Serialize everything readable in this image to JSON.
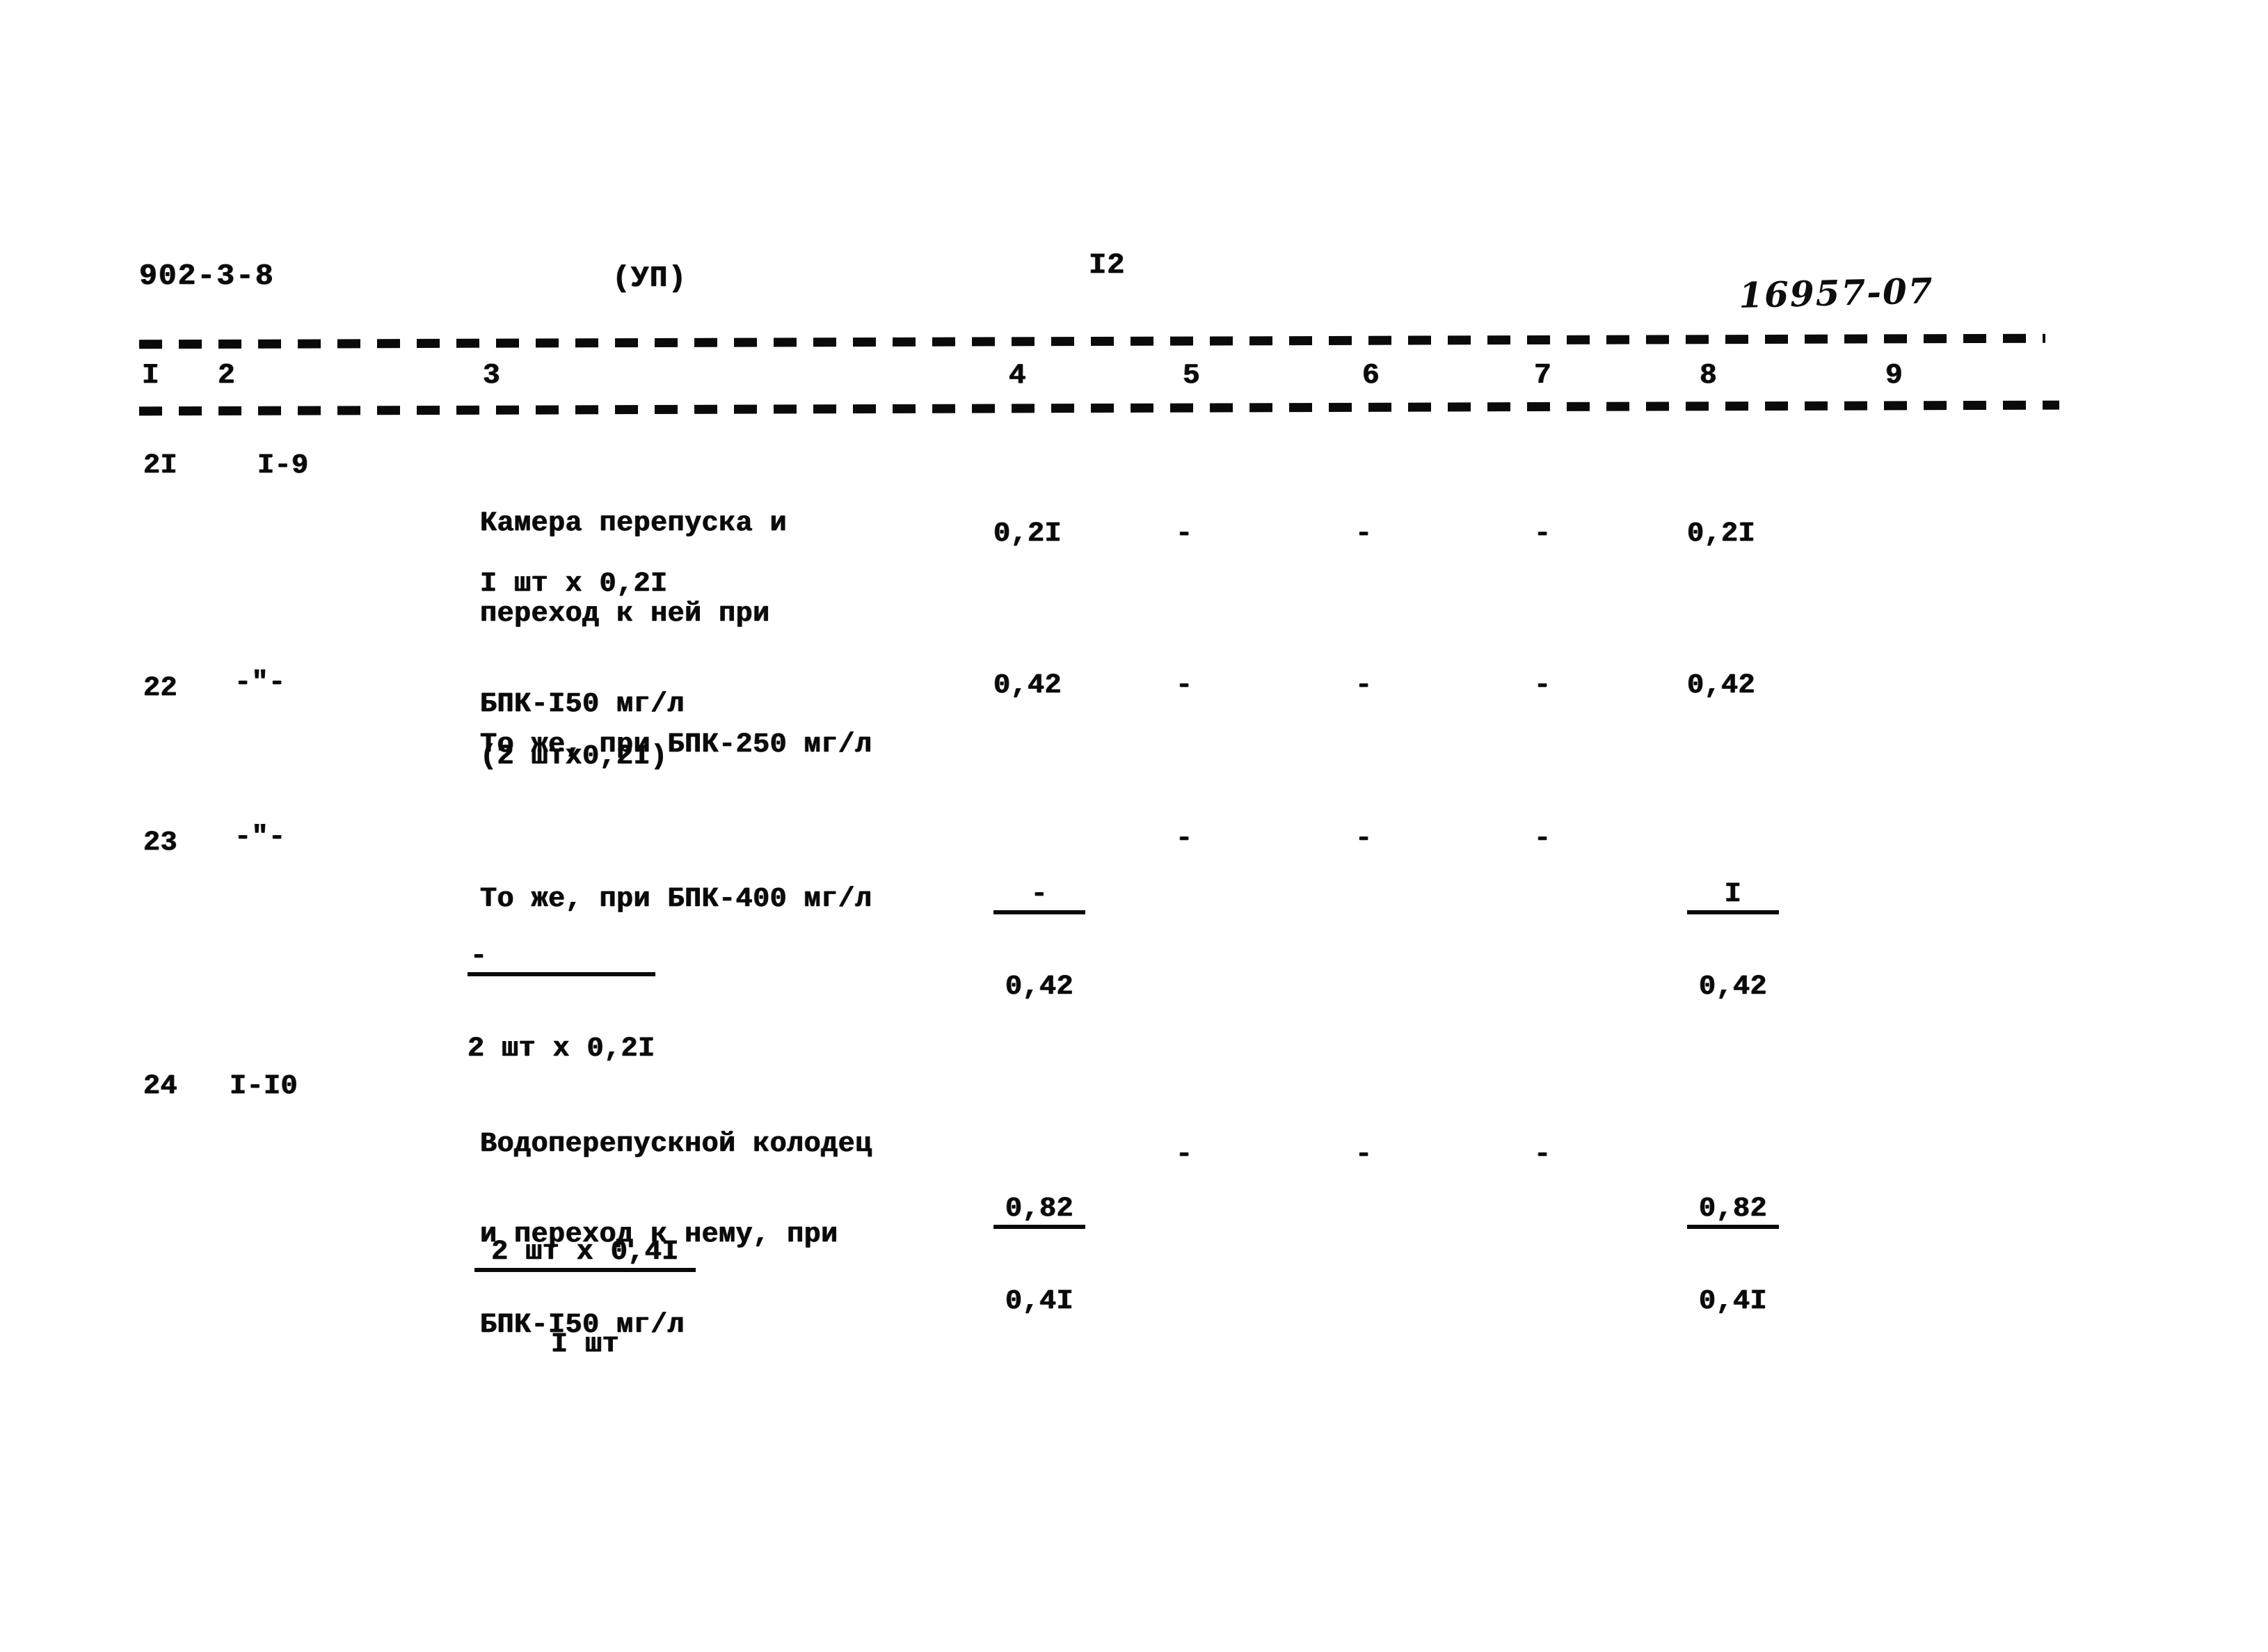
{
  "document": {
    "series_code": "902-3-8",
    "section_marker": "(УП)",
    "page_number": "I2",
    "archive_stamp": "16957-07"
  },
  "table": {
    "column_headers": [
      "I",
      "2",
      "3",
      "4",
      "5",
      "6",
      "7",
      "8",
      "9"
    ],
    "rows": [
      {
        "col1": "2I",
        "col2": "I-9",
        "col3_lines": [
          "Камера перепуска и",
          "переход к ней при",
          "БПК-I50 мг/л"
        ],
        "col3_note": "I шт х 0,2I",
        "col4": "0,2I",
        "col5": "-",
        "col6": "-",
        "col7": "-",
        "col8": "0,2I",
        "col9": ""
      },
      {
        "col1": "22",
        "col2": "-\"-",
        "col3_lines": [
          "То же, при БПК-250 мг/л"
        ],
        "col3_note": "(2 штх0,2I)",
        "col4": "0,42",
        "col5": "-",
        "col6": "-",
        "col7": "-",
        "col8": "0,42",
        "col9": ""
      },
      {
        "col1": "23",
        "col2": "-\"-",
        "col3_lines": [
          "То же, при БПК-400 мг/л"
        ],
        "col3_fraction": {
          "numerator": "-",
          "denominator": "2 шт х 0,2I"
        },
        "col4_fraction": {
          "numerator": "-",
          "denominator": "0,42"
        },
        "col5": "-",
        "col6": "-",
        "col7": "-",
        "col8_fraction": {
          "numerator": "I",
          "denominator": "0,42"
        },
        "col9": ""
      },
      {
        "col1": "24",
        "col2": "I-I0",
        "col3_lines": [
          "Водоперепускной колодец",
          "и переход к нему, при",
          "БПК-I50 мг/л"
        ],
        "col3_fraction": {
          "numerator": "2 шт х 0,4I",
          "denominator": "I шт"
        },
        "col4_fraction": {
          "numerator": "0,82",
          "denominator": "0,4I"
        },
        "col5": "-",
        "col6": "-",
        "col7": "-",
        "col8_fraction": {
          "numerator": "0,82",
          "denominator": "0,4I"
        },
        "col9": ""
      }
    ]
  }
}
